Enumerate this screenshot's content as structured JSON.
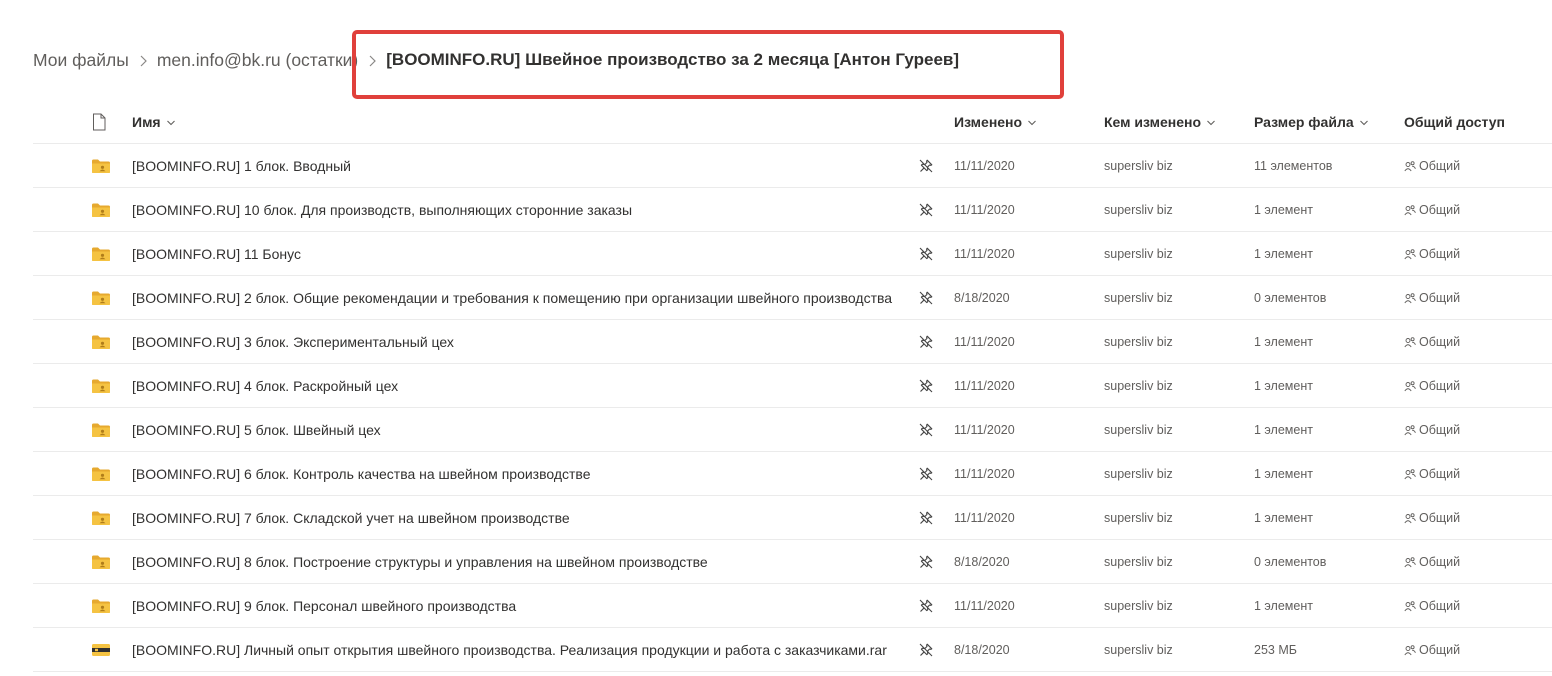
{
  "breadcrumb": {
    "items": [
      "Мои файлы",
      "men.info@bk.ru (остатки)"
    ],
    "current": "[BOOMINFO.RU] Швейное производство за 2 месяца [Антон Гуреев]"
  },
  "columns": {
    "name": "Имя",
    "modified": "Изменено",
    "modified_by": "Кем изменено",
    "size": "Размер файла",
    "sharing": "Общий доступ"
  },
  "files": [
    {
      "name": "[BOOMINFO.RU] 1 блок. Вводный",
      "type": "shared-folder-icon",
      "modified": "11/11/2020",
      "modified_by": "supersliv biz",
      "size": "11 элементов",
      "sharing": "Общий"
    },
    {
      "name": "[BOOMINFO.RU] 10 блок. Для производств, выполняющих сторонние заказы",
      "type": "shared-folder-icon",
      "modified": "11/11/2020",
      "modified_by": "supersliv biz",
      "size": "1 элемент",
      "sharing": "Общий"
    },
    {
      "name": "[BOOMINFO.RU] 11 Бонус",
      "type": "shared-folder-icon",
      "modified": "11/11/2020",
      "modified_by": "supersliv biz",
      "size": "1 элемент",
      "sharing": "Общий"
    },
    {
      "name": "[BOOMINFO.RU] 2 блок. Общие рекомендации и требования к помещению при организации швейного производства",
      "type": "shared-folder-icon",
      "modified": "8/18/2020",
      "modified_by": "supersliv biz",
      "size": "0 элементов",
      "sharing": "Общий"
    },
    {
      "name": "[BOOMINFO.RU] 3 блок. Экспериментальный цех",
      "type": "shared-folder-icon",
      "modified": "11/11/2020",
      "modified_by": "supersliv biz",
      "size": "1 элемент",
      "sharing": "Общий"
    },
    {
      "name": "[BOOMINFO.RU] 4 блок. Раскройный цех",
      "type": "shared-folder-icon",
      "modified": "11/11/2020",
      "modified_by": "supersliv biz",
      "size": "1 элемент",
      "sharing": "Общий"
    },
    {
      "name": "[BOOMINFO.RU] 5 блок. Швейный цех",
      "type": "shared-folder-icon",
      "modified": "11/11/2020",
      "modified_by": "supersliv biz",
      "size": "1 элемент",
      "sharing": "Общий"
    },
    {
      "name": "[BOOMINFO.RU] 6 блок. Контроль качества на швейном производстве",
      "type": "shared-folder-icon",
      "modified": "11/11/2020",
      "modified_by": "supersliv biz",
      "size": "1 элемент",
      "sharing": "Общий"
    },
    {
      "name": "[BOOMINFO.RU] 7 блок. Складской учет на швейном производстве",
      "type": "shared-folder-icon",
      "modified": "11/11/2020",
      "modified_by": "supersliv biz",
      "size": "1 элемент",
      "sharing": "Общий"
    },
    {
      "name": "[BOOMINFO.RU] 8 блок. Построение структуры и управления на швейном производстве",
      "type": "shared-folder-icon",
      "modified": "8/18/2020",
      "modified_by": "supersliv biz",
      "size": "0 элементов",
      "sharing": "Общий"
    },
    {
      "name": "[BOOMINFO.RU] 9 блок. Персонал швейного производства",
      "type": "shared-folder-icon",
      "modified": "11/11/2020",
      "modified_by": "supersliv biz",
      "size": "1 элемент",
      "sharing": "Общий"
    },
    {
      "name": "[BOOMINFO.RU] Личный опыт открытия швейного производства. Реализация продукции и работа с заказчиками.rar",
      "type": "archive-file-icon",
      "modified": "8/18/2020",
      "modified_by": "supersliv biz",
      "size": "253 МБ",
      "sharing": "Общий"
    }
  ],
  "colors": {
    "folder": "#f5c342",
    "folder_back": "#e6a92f",
    "highlight": "#e0403b",
    "text_primary": "#323130",
    "text_secondary": "#605e5c"
  }
}
